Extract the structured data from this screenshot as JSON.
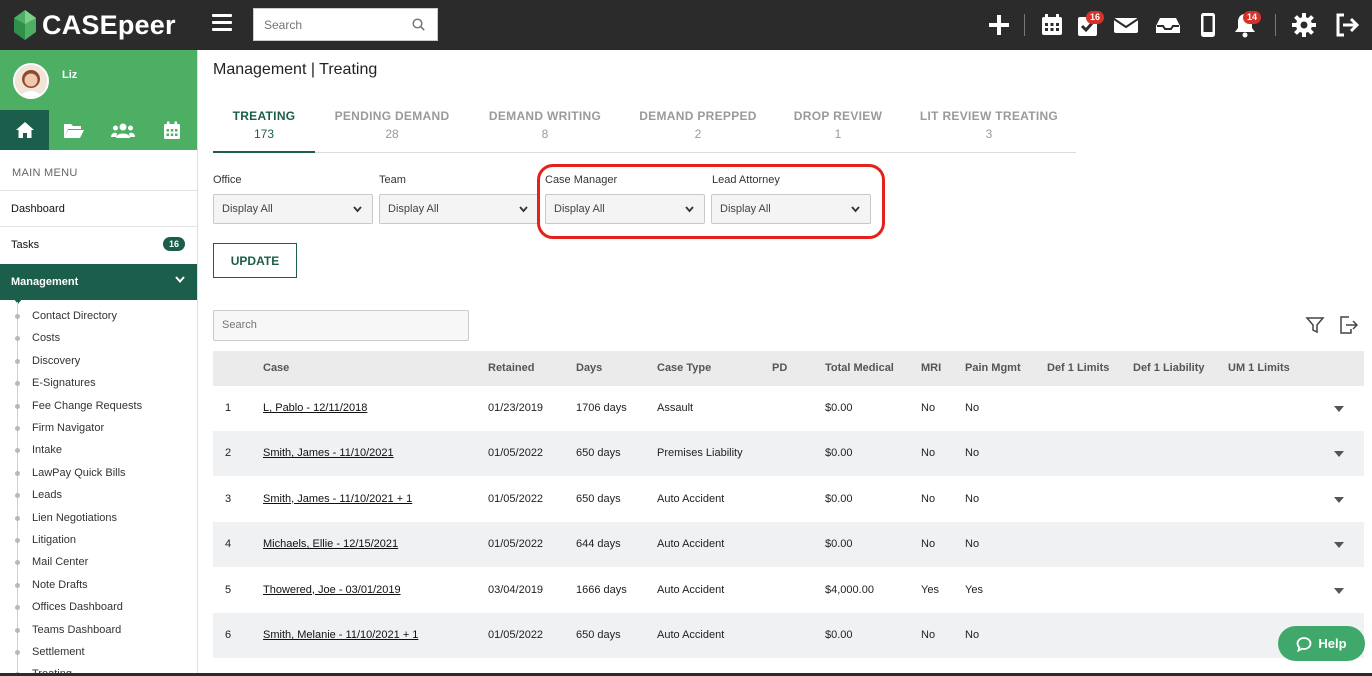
{
  "app": {
    "logo_text": "CASEpeer",
    "search_placeholder": "Search",
    "badges": {
      "tasks": "16",
      "notifications": "14"
    }
  },
  "colors": {
    "brand_green": "#4caf63",
    "dark_green": "#1a5e4b",
    "topbar": "#2b2b2b",
    "alert_red": "#d7322a",
    "highlight": "#e4221b"
  },
  "sidebar": {
    "user_name": "Liz",
    "quicknav_icons": [
      "home-icon",
      "folder-icon",
      "users-icon",
      "calendar-icon"
    ],
    "menu_title": "MAIN MENU",
    "items": [
      {
        "label": "Dashboard"
      },
      {
        "label": "Tasks",
        "badge": "16"
      },
      {
        "label": "Management"
      }
    ],
    "submenu": [
      "Contact Directory",
      "Costs",
      "Discovery",
      "E-Signatures",
      "Fee Change Requests",
      "Firm Navigator",
      "Intake",
      "LawPay Quick Bills",
      "Leads",
      "Lien Negotiations",
      "Litigation",
      "Mail Center",
      "Note Drafts",
      "Offices Dashboard",
      "Teams Dashboard",
      "Settlement",
      "Treating"
    ]
  },
  "page": {
    "title": "Management | Treating"
  },
  "tabs": [
    {
      "label": "TREATING",
      "count": "173"
    },
    {
      "label": "PENDING DEMAND",
      "count": "28"
    },
    {
      "label": "DEMAND WRITING",
      "count": "8"
    },
    {
      "label": "DEMAND PREPPED",
      "count": "2"
    },
    {
      "label": "DROP REVIEW",
      "count": "1"
    },
    {
      "label": "LIT REVIEW TREATING",
      "count": "3"
    }
  ],
  "filters": [
    {
      "label": "Office",
      "value": "Display All"
    },
    {
      "label": "Team",
      "value": "Display All"
    },
    {
      "label": "Case Manager",
      "value": "Display All"
    },
    {
      "label": "Lead Attorney",
      "value": "Display All"
    }
  ],
  "update_label": "UPDATE",
  "table": {
    "search_placeholder": "Search",
    "columns": [
      "Case",
      "Retained",
      "Days",
      "Case Type",
      "PD",
      "Total Medical",
      "MRI",
      "Pain Mgmt",
      "Def 1 Limits",
      "Def 1 Liability",
      "UM 1 Limits"
    ],
    "rows": [
      {
        "num": "1",
        "case": "L, Pablo - 12/11/2018",
        "retained": "01/23/2019",
        "days": "1706 days",
        "type": "Assault",
        "pd": "",
        "medical": "$0.00",
        "mri": "No",
        "pain": "No"
      },
      {
        "num": "2",
        "case": "Smith, James - 11/10/2021",
        "retained": "01/05/2022",
        "days": "650 days",
        "type": "Premises Liability",
        "pd": "",
        "medical": "$0.00",
        "mri": "No",
        "pain": "No"
      },
      {
        "num": "3",
        "case": "Smith, James - 11/10/2021 + 1",
        "retained": "01/05/2022",
        "days": "650 days",
        "type": "Auto Accident",
        "pd": "",
        "medical": "$0.00",
        "mri": "No",
        "pain": "No"
      },
      {
        "num": "4",
        "case": "Michaels, Ellie - 12/15/2021",
        "retained": "01/05/2022",
        "days": "644 days",
        "type": "Auto Accident",
        "pd": "",
        "medical": "$0.00",
        "mri": "No",
        "pain": "No"
      },
      {
        "num": "5",
        "case": "Thowered, Joe - 03/01/2019",
        "retained": "03/04/2019",
        "days": "1666 days",
        "type": "Auto Accident",
        "pd": "",
        "medical": "$4,000.00",
        "mri": "Yes",
        "pain": "Yes"
      },
      {
        "num": "6",
        "case": "Smith, Melanie - 11/10/2021 + 1",
        "retained": "01/05/2022",
        "days": "650 days",
        "type": "Auto Accident",
        "pd": "",
        "medical": "$0.00",
        "mri": "No",
        "pain": "No"
      }
    ]
  },
  "help_label": "Help"
}
